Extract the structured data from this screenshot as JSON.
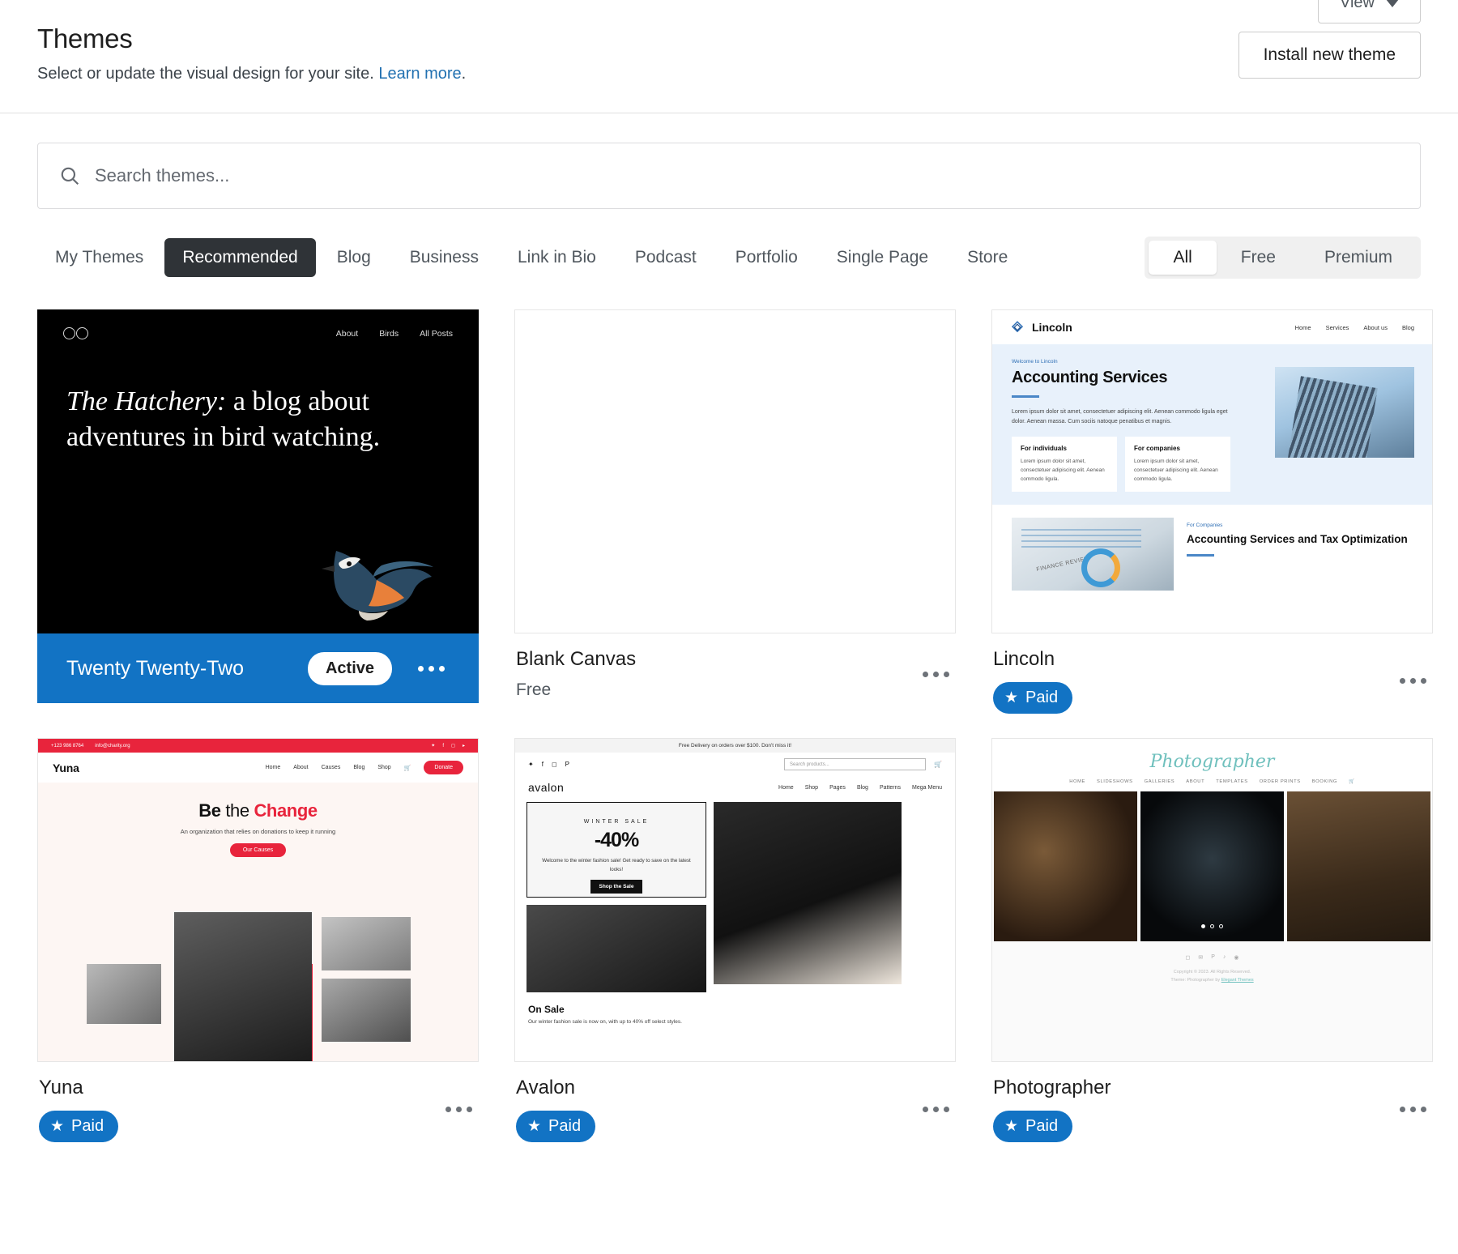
{
  "header": {
    "title": "Themes",
    "subtitle": "Select or update the visual design for your site.",
    "learn_more": "Learn more",
    "period": ".",
    "view_button": "View",
    "install_button": "Install new theme"
  },
  "search": {
    "placeholder": "Search themes...",
    "value": "",
    "icon": "search-icon"
  },
  "filters": {
    "tabs": [
      {
        "label": "My Themes",
        "active": false
      },
      {
        "label": "Recommended",
        "active": true
      },
      {
        "label": "Blog",
        "active": false
      },
      {
        "label": "Business",
        "active": false
      },
      {
        "label": "Link in Bio",
        "active": false
      },
      {
        "label": "Podcast",
        "active": false
      },
      {
        "label": "Portfolio",
        "active": false
      },
      {
        "label": "Single Page",
        "active": false
      },
      {
        "label": "Store",
        "active": false
      }
    ],
    "segments": [
      {
        "label": "All",
        "active": true
      },
      {
        "label": "Free",
        "active": false
      },
      {
        "label": "Premium",
        "active": false
      }
    ]
  },
  "colors": {
    "accent_blue": "#1273c4",
    "active_tab_bg": "#2f3337",
    "link_blue": "#2271b1",
    "yuna_red": "#e8243c",
    "photographer_teal": "#6fc0bd",
    "lincoln_blue": "#2f6fb5"
  },
  "themes": [
    {
      "name": "Twenty Twenty-Two",
      "status": "Active",
      "price": "",
      "is_active": true,
      "menu_label": "more-options"
    },
    {
      "name": "Blank Canvas",
      "price": "Free",
      "is_active": false,
      "menu_label": "more-options"
    },
    {
      "name": "Lincoln",
      "price": "Paid",
      "is_active": false,
      "menu_label": "more-options"
    },
    {
      "name": "Yuna",
      "price": "Paid",
      "is_active": false,
      "menu_label": "more-options"
    },
    {
      "name": "Avalon",
      "price": "Paid",
      "is_active": false,
      "menu_label": "more-options"
    },
    {
      "name": "Photographer",
      "price": "Paid",
      "is_active": false,
      "menu_label": "more-options"
    }
  ],
  "previews": {
    "twentytwentytwo": {
      "nav": [
        "About",
        "Birds",
        "All Posts"
      ],
      "headline_italic": "The Hatchery:",
      "headline_rest": " a blog about adventures in bird watching."
    },
    "lincoln": {
      "brand": "Lincoln",
      "nav": [
        "Home",
        "Services",
        "About us",
        "Blog"
      ],
      "eyebrow": "Welcome to Lincoln",
      "heading": "Accounting Services",
      "paragraph": "Lorem ipsum dolor sit amet, consectetuer adipiscing elit. Aenean commodo ligula eget dolor. Aenean massa. Cum sociis natoque penatibus et magnis.",
      "cards": [
        {
          "title": "For individuals",
          "body": "Lorem ipsum dolor sit amet, consectetuer adipiscing elit. Aenean commodo ligula."
        },
        {
          "title": "For companies",
          "body": "Lorem ipsum dolor sit amet, consectetuer adipiscing elit. Aenean commodo ligula."
        }
      ],
      "photo_caption": "FINANCE REVIEW",
      "bottom_eyebrow": "For Companies",
      "bottom_heading": "Accounting Services and Tax Optimization"
    },
    "yuna": {
      "phone": "+123 986 8764",
      "email": "info@charity.org",
      "brand": "Yuna",
      "nav": [
        "Home",
        "About",
        "Causes",
        "Blog",
        "Shop"
      ],
      "donate": "Donate",
      "headline_1": "Be",
      "headline_2": "the",
      "headline_3": "Change",
      "subline": "An organization that relies on donations to keep it running",
      "cta": "Our Causes"
    },
    "avalon": {
      "announcement": "Free Delivery on orders over $100. Don't miss it!",
      "search_placeholder": "Search products...",
      "brand": "avalon",
      "nav": [
        "Home",
        "Shop",
        "Pages",
        "Blog",
        "Patterns",
        "Mega Menu"
      ],
      "sale_kicker": "WINTER SALE",
      "sale_pct": "-40%",
      "sale_copy": "Welcome to the winter fashion sale! Get ready to save on the latest looks!",
      "sale_button": "Shop the Sale",
      "onsale_title": "On Sale",
      "onsale_copy": "Our winter fashion sale is now on, with up to 40% off select styles."
    },
    "photographer": {
      "logo": "Photographer",
      "nav": [
        "HOME",
        "SLIDESHOWS",
        "GALLERIES",
        "ABOUT",
        "TEMPLATES",
        "ORDER PRINTS",
        "BOOKING"
      ],
      "copyright": "Copyright © 2023. All Rights Reserved.",
      "credit_text": "Theme: Photographer by ",
      "credit_link": "Elegant Themes"
    }
  }
}
